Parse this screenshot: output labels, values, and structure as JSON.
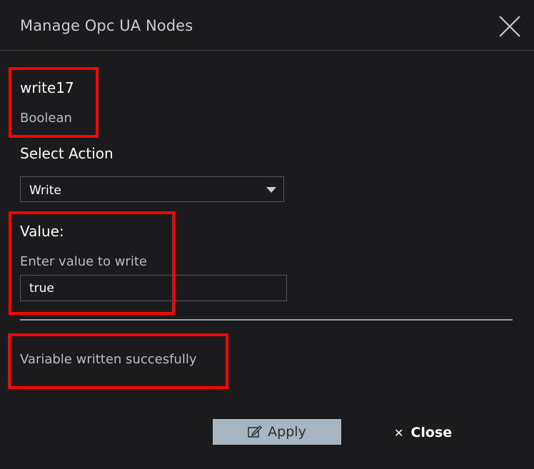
{
  "dialog": {
    "title": "Manage Opc UA Nodes",
    "close_icon": "close-icon"
  },
  "node": {
    "name": "write17",
    "type": "Boolean"
  },
  "action": {
    "label": "Select Action",
    "selected": "Write"
  },
  "value": {
    "label": "Value:",
    "hint": "Enter value to write",
    "current": "true"
  },
  "status": {
    "message": "Variable written succesfully"
  },
  "footer": {
    "apply_label": "Apply",
    "apply_icon": "edit-icon",
    "close_label": "Close",
    "close_icon": "close-icon"
  },
  "colors": {
    "background": "#1b1b1e",
    "highlight": "#ff0000",
    "apply_button": "#a9b5c1"
  }
}
